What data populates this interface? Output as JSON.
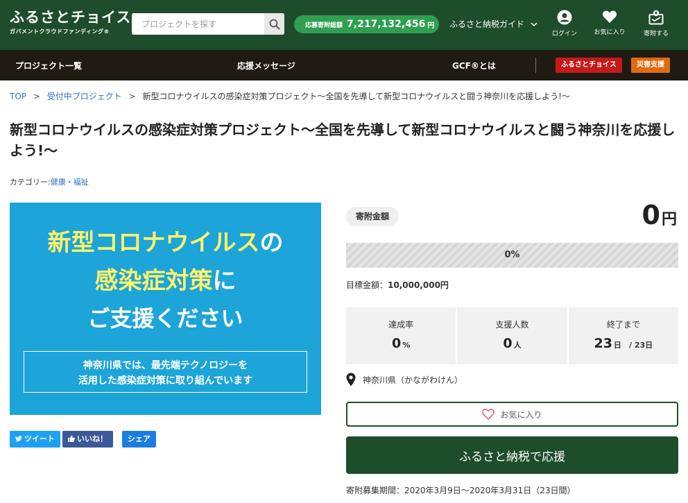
{
  "header": {
    "logo": "ふるさとチョイス",
    "logo_sub": "ガバメントクラウドファンディング®",
    "search_placeholder": "プロジェクトを探す",
    "total_label": "応募寄附総額",
    "total_value": "7,217,132,456",
    "total_unit": "円",
    "guide": "ふるさと納税ガイド",
    "login": "ログイン",
    "favorites": "お気に入り",
    "donate": "寄附する"
  },
  "nav": {
    "projects": "プロジェクト一覧",
    "messages": "応援メッセージ",
    "gcf": "GCF®とは",
    "furusato_choice": "ふるさとチョイス",
    "disaster": "災害支援"
  },
  "breadcrumb": {
    "top": "TOP",
    "accepting": "受付中プロジェクト",
    "current": "新型コロナウイルスの感染症対策プロジェクト〜全国を先導して新型コロナウイルスと闘う神奈川を応援しよう!〜"
  },
  "project": {
    "title": "新型コロナウイルスの感染症対策プロジェクト〜全国を先導して新型コロナウイルスと闘う神奈川を応援しよう!〜",
    "category_label": "カテゴリー:",
    "category": "健康・福祉"
  },
  "hero": {
    "line1_a": "新型コロナウイルス",
    "line1_b": "の",
    "line2_a": "感染症対策",
    "line2_b": "に",
    "line3": "ご支援ください",
    "box_line1": "神奈川県では、最先端テクノロジーを",
    "box_line2": "活用した感染症対策に取り組んでいます"
  },
  "share": {
    "tweet": "ツイート",
    "like": "いいね！",
    "share": "シェア"
  },
  "donation": {
    "amount_label": "寄附金額",
    "amount_value": "0",
    "amount_unit": "円",
    "progress_percent": 0,
    "progress_text": "0%",
    "target_label": "目標金額：",
    "target_value": "10,000,000円",
    "rate_label": "達成率",
    "rate_value": "0",
    "rate_unit": "%",
    "supporters_label": "支援人数",
    "supporters_value": "0",
    "supporters_unit": "人",
    "remaining_label": "終了まで",
    "remaining_value": "23",
    "remaining_unit": "日",
    "remaining_total": "/ 23日",
    "location": "神奈川県（かながわけん）",
    "favorite_button": "お気に入り",
    "donate_button": "ふるさと納税で応援",
    "period": "寄附募集期間：2020年3月9日〜2020年3月31日（23日間）"
  },
  "colors": {
    "header_green": "#1e4d2b",
    "pill_green": "#2f9e4f",
    "nav_dark": "#1f1b12",
    "hero_blue": "#1da4d8",
    "hero_yellow": "#fff46a",
    "link_blue": "#2a6fc2",
    "badge_red": "#c41a1a",
    "badge_orange": "#e06a10"
  },
  "icons": {
    "search": "search-icon",
    "login": "user-icon",
    "favorites": "heart-icon",
    "donate": "donation-box-icon",
    "location": "map-pin-icon",
    "favorite_button": "heart-outline-icon",
    "guide": "chevron-down-icon",
    "tweet": "twitter-icon",
    "like": "thumbs-up-icon"
  }
}
